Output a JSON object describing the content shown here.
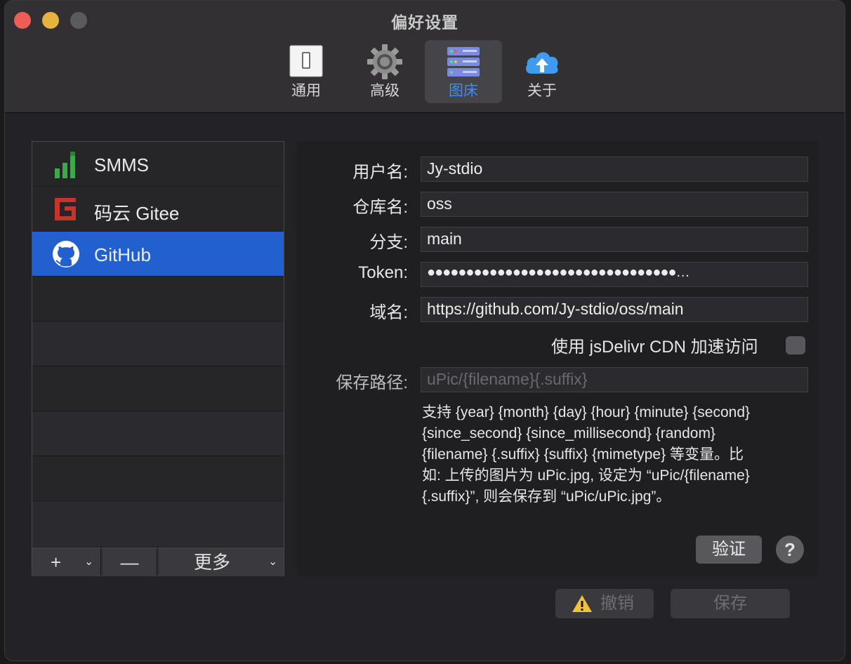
{
  "window": {
    "title": "偏好设置"
  },
  "toolbar": {
    "items": [
      {
        "label": "通用",
        "icon": "switch-icon"
      },
      {
        "label": "高级",
        "icon": "gear-icon"
      },
      {
        "label": "图床",
        "icon": "server-icon",
        "active": true
      },
      {
        "label": "关于",
        "icon": "cloud-upload-icon"
      }
    ]
  },
  "sidebar": {
    "items": [
      {
        "label": "SMMS",
        "icon": "bars-icon"
      },
      {
        "label": "码云 Gitee",
        "icon": "gitee-icon"
      },
      {
        "label": "GitHub",
        "icon": "github-icon",
        "selected": true
      }
    ],
    "bottom": {
      "add": "+",
      "remove": "—",
      "more": "更多"
    }
  },
  "form": {
    "username_label": "用户名:",
    "username_value": "Jy-stdio",
    "repo_label": "仓库名:",
    "repo_value": "oss",
    "branch_label": "分支:",
    "branch_value": "main",
    "token_label": "Token:",
    "token_value": "●●●●●●●●●●●●●●●●●●●●●●●●●●●●●●●●…",
    "domain_label": "域名:",
    "domain_value": "https://github.com/Jy-stdio/oss/main",
    "cdn_label": "使用 jsDelivr CDN 加速访问",
    "cdn_checked": false,
    "save_path_label": "保存路径:",
    "save_path_placeholder": "uPic/{filename}{.suffix}",
    "help_lines": [
      "支持 {year} {month} {day} {hour} {minute} {second}",
      "{since_second} {since_millisecond} {random}",
      "{filename} {.suffix} {suffix} {mimetype} 等变量。比",
      "如: 上传的图片为 uPic.jpg, 设定为 “uPic/{filename}",
      "{.suffix}”, 则会保存到 “uPic/uPic.jpg”。"
    ],
    "verify_label": "验证",
    "help_label": "?"
  },
  "footer": {
    "revert_label": "撤销",
    "save_label": "保存"
  }
}
